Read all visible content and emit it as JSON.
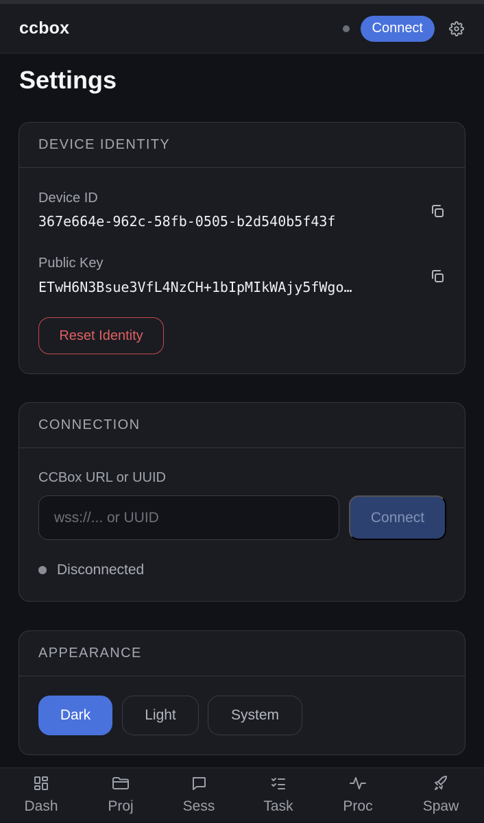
{
  "app": {
    "title": "ccbox"
  },
  "header": {
    "connect_label": "Connect",
    "settings_icon": "gear-icon"
  },
  "page": {
    "title": "Settings"
  },
  "device_identity": {
    "section_title": "DEVICE IDENTITY",
    "device_id_label": "Device ID",
    "device_id_value": "367e664e-962c-58fb-0505-b2d540b5f43f",
    "public_key_label": "Public Key",
    "public_key_value": "ETwH6N3Bsue3VfL4NzCH+1bIpMIkWAjy5fWgo…",
    "reset_label": "Reset Identity"
  },
  "connection": {
    "section_title": "CONNECTION",
    "url_label": "CCBox URL or UUID",
    "url_value": "",
    "url_placeholder": "wss://... or UUID",
    "connect_label": "Connect",
    "status_text": "Disconnected"
  },
  "appearance": {
    "section_title": "APPEARANCE",
    "options": [
      "Dark",
      "Light",
      "System"
    ],
    "selected": "Dark"
  },
  "nav": {
    "items": [
      {
        "label": "Dash",
        "icon": "dashboard-icon"
      },
      {
        "label": "Proj",
        "icon": "folder-icon"
      },
      {
        "label": "Sess",
        "icon": "chat-icon"
      },
      {
        "label": "Task",
        "icon": "checklist-icon"
      },
      {
        "label": "Proc",
        "icon": "activity-icon"
      },
      {
        "label": "Spaw",
        "icon": "rocket-icon"
      }
    ]
  },
  "colors": {
    "background": "#111217",
    "surface": "#1a1c22",
    "accent": "#4a72dc",
    "danger": "#e06060"
  }
}
